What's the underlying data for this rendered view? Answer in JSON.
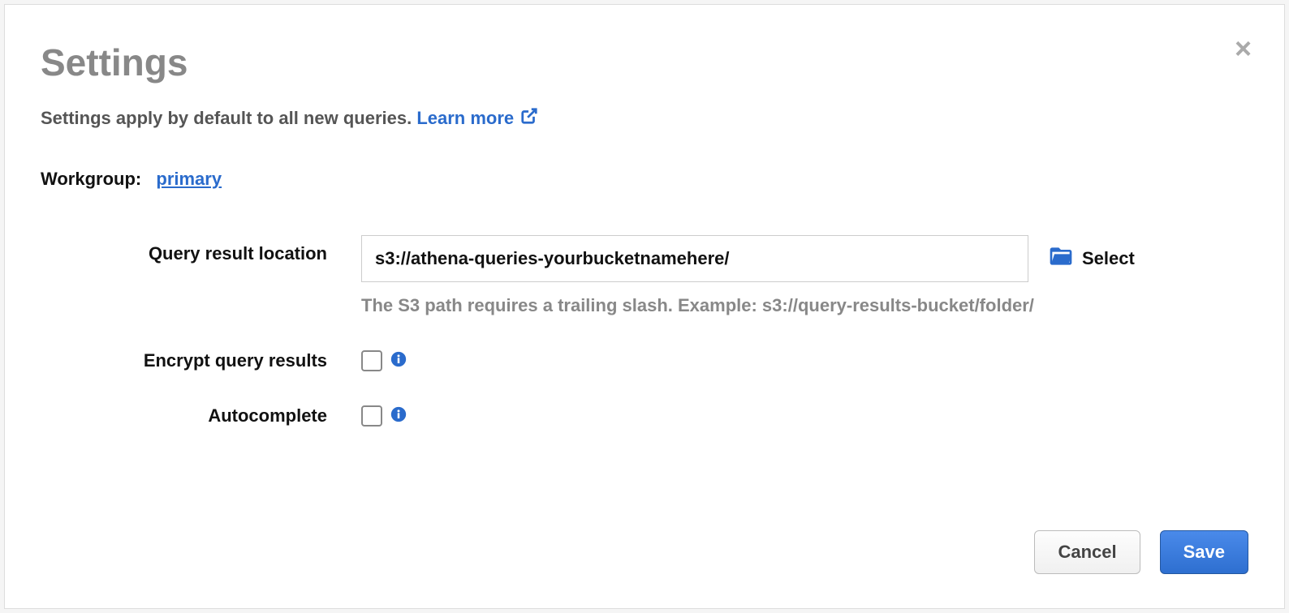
{
  "modal": {
    "title": "Settings",
    "subtitle_prefix": "Settings apply by default to all new queries. ",
    "learn_more_label": "Learn more",
    "close_label": "×"
  },
  "workgroup": {
    "label": "Workgroup:",
    "value": "primary"
  },
  "query_location": {
    "label": "Query result location",
    "value": "s3://athena-queries-yourbucketnamehere/",
    "select_label": "Select",
    "hint": "The S3 path requires a trailing slash. Example: s3://query-results-bucket/folder/"
  },
  "encrypt": {
    "label": "Encrypt query results",
    "checked": false
  },
  "autocomplete": {
    "label": "Autocomplete",
    "checked": false
  },
  "footer": {
    "cancel_label": "Cancel",
    "save_label": "Save"
  }
}
